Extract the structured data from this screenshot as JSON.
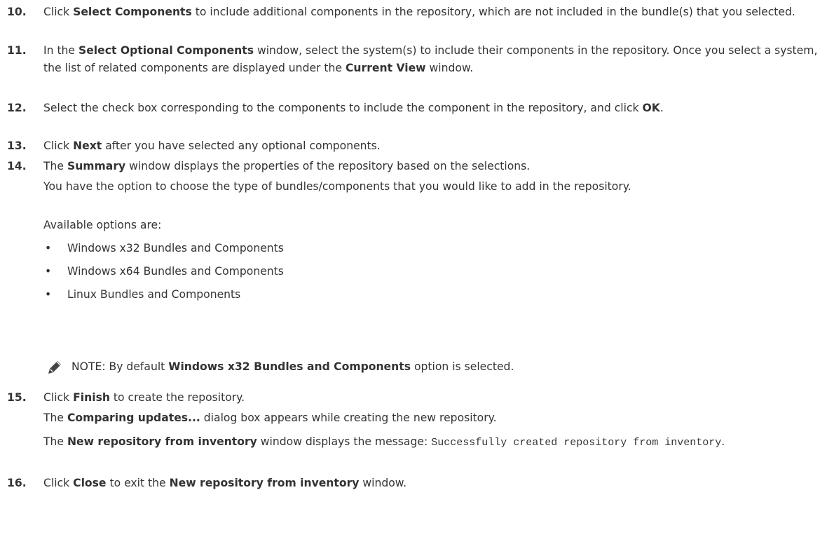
{
  "steps": {
    "s10": {
      "num": "10.",
      "t1": "Click ",
      "b1": "Select Components",
      "t2": " to include additional components in the repository, which are not included in the bundle(s) that you selected."
    },
    "s11": {
      "num": "11.",
      "t1": "In the ",
      "b1": "Select Optional Components",
      "t2": " window, select the system(s) to include their components in the repository. Once you select a system, the list of related components are displayed under the ",
      "b2": "Current View",
      "t3": " window."
    },
    "s12": {
      "num": "12.",
      "t1": "Select the check box corresponding to the components to include the component in the repository, and click ",
      "b1": "OK",
      "t2": "."
    },
    "s13": {
      "num": "13.",
      "t1": "Click ",
      "b1": "Next",
      "t2": " after you have selected any optional components."
    },
    "s14": {
      "num": "14.",
      "t1": "The ",
      "b1": "Summary",
      "t2": " window displays the properties of the repository based on the selections.",
      "p1": "You have the option to choose the type of bundles/components that you would like to add in the repository.",
      "p2": "Available options are:",
      "bullets": [
        "Windows x32 Bundles and Components",
        "Windows x64 Bundles and Components",
        "Linux Bundles and Components"
      ],
      "bullet_char": "•",
      "note_label": "NOTE:",
      "note_t1": " By default ",
      "note_b1": "Windows x32 Bundles and Components",
      "note_t2": " option is selected."
    },
    "s15": {
      "num": "15.",
      "t1": "Click ",
      "b1": "Finish",
      "t2": " to create the repository.",
      "p1_b": "Comparing updates...",
      "p1_t": " dialog box appears while creating the new repository.",
      "p1_pre": "The ",
      "p2_pre": "The ",
      "p2_b": "New repository from inventory",
      "p2_t": " window displays the message: ",
      "p2_code": "Successfully created repository from inventory",
      "p2_end": "."
    },
    "s16": {
      "num": "16.",
      "t1": "Click ",
      "b1": "Close",
      "t2": " to exit the ",
      "b2": "New repository from inventory",
      "t3": " window."
    }
  },
  "icons": {
    "note": "pencil-note-icon"
  },
  "colors": {
    "text": "#333333",
    "icon": "#444444"
  }
}
